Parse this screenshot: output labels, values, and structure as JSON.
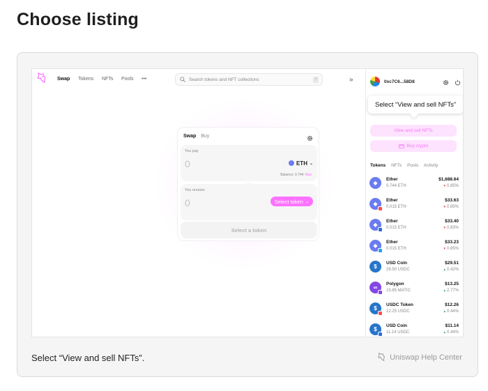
{
  "page": {
    "title": "Choose listing"
  },
  "caption": "Select “View and sell NFTs”.",
  "help_center": "Uniswap Help Center",
  "colors": {
    "accent_pink": "#fc72ff",
    "up": "#2ea86b",
    "down": "#e0454d"
  },
  "nav": {
    "logo": "uniswap-unicorn-icon",
    "items": [
      "Swap",
      "Tokens",
      "NFTs",
      "Pools",
      "•••"
    ],
    "search_placeholder": "Search tokens and NFT collections",
    "search_shortcut": "/",
    "collapse_icon": "»"
  },
  "swap": {
    "tabs": [
      "Swap",
      "Buy"
    ],
    "pay_label": "You pay",
    "pay_amount": "0",
    "pay_token": "ETH",
    "balance_label": "Balance: 0.744",
    "max_label": "Max",
    "receive_label": "You receive",
    "receive_amount": "0",
    "select_token_label": "Select token",
    "cta_label": "Select a token"
  },
  "drawer": {
    "address": "0xc7C6...58D8",
    "tooltip": "Select “View and sell NFTs”",
    "view_nfts_label": "View and sell NFTs",
    "buy_crypto_label": "Buy crypto",
    "tabs": [
      "Tokens",
      "NFTs",
      "Pools",
      "Activity"
    ],
    "tokens": [
      {
        "name": "Ether",
        "balance": "0.744 ETH",
        "value": "$1,688.64",
        "change": "0.85%",
        "dir": "down",
        "icon": "eth",
        "color": "#6b7cf0",
        "badge": ""
      },
      {
        "name": "Ether",
        "balance": "0.015 ETH",
        "value": "$33.63",
        "change": "0.85%",
        "dir": "down",
        "icon": "eth",
        "color": "#6b7cf0",
        "badge": "#ff4d4d"
      },
      {
        "name": "Ether",
        "balance": "0.015 ETH",
        "value": "$33.40",
        "change": "0.83%",
        "dir": "down",
        "icon": "eth",
        "color": "#6b7cf0",
        "badge": "#2d6cdf"
      },
      {
        "name": "Ether",
        "balance": "0.015 ETH",
        "value": "$33.23",
        "change": "0.85%",
        "dir": "down",
        "icon": "eth",
        "color": "#6b7cf0",
        "badge": "#28a0f0"
      },
      {
        "name": "USD Coin",
        "balance": "29.50 USDC",
        "value": "$29.51",
        "change": "0.42%",
        "dir": "up",
        "icon": "usdc",
        "color": "#2775ca",
        "badge": ""
      },
      {
        "name": "Polygon",
        "balance": "15.85 MATIC",
        "value": "$13.25",
        "change": "2.77%",
        "dir": "up",
        "icon": "matic",
        "color": "#8247e5",
        "badge": "#8247e5"
      },
      {
        "name": "USDC Token",
        "balance": "12.25 USDC",
        "value": "$12.26",
        "change": "0.44%",
        "dir": "up",
        "icon": "usdc",
        "color": "#2775ca",
        "badge": "#ff4d4d"
      },
      {
        "name": "USD Coin",
        "balance": "11.14 USDC",
        "value": "$11.14",
        "change": "0.44%",
        "dir": "up",
        "icon": "usdc",
        "color": "#2775ca",
        "badge": "#2d6cdf"
      }
    ]
  }
}
